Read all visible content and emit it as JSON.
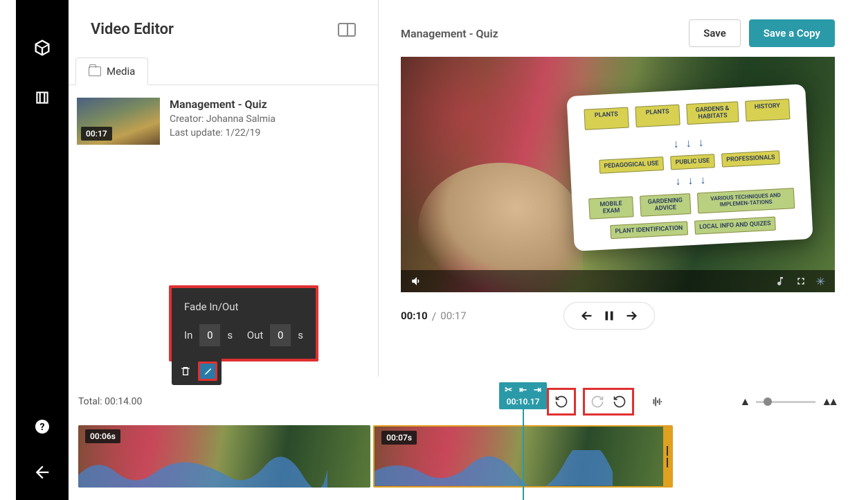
{
  "page": {
    "title": "Video Editor"
  },
  "tabs": {
    "media": "Media"
  },
  "mediaItem": {
    "title": "Management - Quiz",
    "creator": "Creator: Johanna Salmia",
    "updated": "Last update: 1/22/19",
    "thumbDuration": "00:17"
  },
  "preview": {
    "title": "Management - Quiz",
    "saveLabel": "Save",
    "saveCopyLabel": "Save a Copy",
    "currentTime": "00:10",
    "duration": "00:17"
  },
  "tablet": {
    "r1": [
      "PLANTS",
      "PLANTS",
      "GARDENS & HABITATS",
      "HISTORY"
    ],
    "r2": [
      "PEDAGOGICAL USE",
      "PUBLIC USE",
      "PROFESSIONALS"
    ],
    "r3": [
      "MOBILE EXAM",
      "GARDENING ADVICE",
      "VARIOUS TECHNIQUES AND IMPLEMEN-TATIONS"
    ],
    "r4": [
      "PLANT IDENTIFICATION",
      "LOCAL INFO AND QUIZES"
    ]
  },
  "fade": {
    "title": "Fade In/Out",
    "inLabel": "In",
    "inVal": "0",
    "inUnit": "s",
    "outLabel": "Out",
    "outVal": "0",
    "outUnit": "s"
  },
  "timeline": {
    "totalLabel": "Total: 00:14.00",
    "clip1Dur": "00:06s",
    "clip2Dur": "00:07s",
    "playhead": "00:10.17"
  }
}
